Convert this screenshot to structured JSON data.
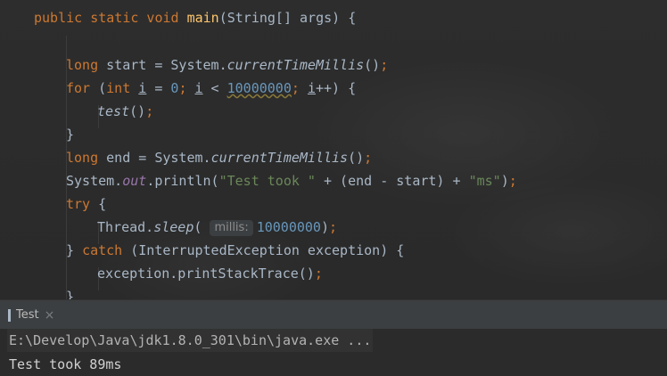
{
  "editor": {
    "lines": [
      {
        "parts": [
          [
            "kw",
            "public static void "
          ],
          [
            "fn",
            "main"
          ],
          [
            "",
            "(String[] args) {"
          ]
        ]
      },
      {
        "parts": []
      },
      {
        "parts": [
          [
            "kw",
            "long "
          ],
          [
            "",
            "start = System."
          ],
          [
            "sm",
            "currentTimeMillis"
          ],
          [
            "",
            "()"
          ],
          [
            "kw",
            ";"
          ]
        ]
      },
      {
        "parts": [
          [
            "kw",
            "for "
          ],
          [
            "",
            "("
          ],
          [
            "kw",
            "int "
          ],
          [
            "ul",
            "i"
          ],
          [
            "",
            " = "
          ],
          [
            "num",
            "0"
          ],
          [
            "kw",
            "; "
          ],
          [
            "ul",
            "i"
          ],
          [
            "",
            " < "
          ],
          [
            "numwavy",
            "10000000"
          ],
          [
            "kw",
            "; "
          ],
          [
            "ul",
            "i"
          ],
          [
            "",
            "++) {"
          ]
        ]
      },
      {
        "parts": [
          [
            "sm",
            "test"
          ],
          [
            "",
            "()"
          ],
          [
            "kw",
            ";"
          ]
        ]
      },
      {
        "parts": [
          [
            "",
            "}"
          ]
        ]
      },
      {
        "parts": [
          [
            "kw",
            "long "
          ],
          [
            "",
            "end = System."
          ],
          [
            "sm",
            "currentTimeMillis"
          ],
          [
            "",
            "()"
          ],
          [
            "kw",
            ";"
          ]
        ]
      },
      {
        "parts": [
          [
            "",
            "System."
          ],
          [
            "sf",
            "out"
          ],
          [
            "",
            ".println("
          ],
          [
            "str",
            "\"Test took \""
          ],
          [
            "",
            " + (end - start) + "
          ],
          [
            "str",
            "\"ms\""
          ],
          [
            "",
            ")"
          ],
          [
            "kw",
            ";"
          ]
        ]
      },
      {
        "parts": [
          [
            "kw",
            "try "
          ],
          [
            "",
            "{"
          ]
        ]
      },
      {
        "parts": [
          [
            "",
            "Thread."
          ],
          [
            "sm",
            "sleep"
          ],
          [
            "",
            "( "
          ],
          [
            "hint",
            "millis:"
          ],
          [
            "num",
            "10000000"
          ],
          [
            "",
            ")"
          ],
          [
            "kw",
            ";"
          ]
        ]
      },
      {
        "parts": [
          [
            "",
            "} "
          ],
          [
            "kw",
            "catch "
          ],
          [
            "",
            "(InterruptedException exception) {"
          ]
        ]
      },
      {
        "parts": [
          [
            "",
            "exception.printStackTrace()"
          ],
          [
            "kw",
            ";"
          ]
        ]
      },
      {
        "parts": [
          [
            "",
            "}"
          ]
        ]
      }
    ]
  },
  "run_panel": {
    "tab_label": "Test",
    "close_glyph": "×"
  },
  "console": {
    "command_line": "E:\\Develop\\Java\\jdk1.8.0_301\\bin\\java.exe ...",
    "output_line": "Test took 89ms"
  }
}
